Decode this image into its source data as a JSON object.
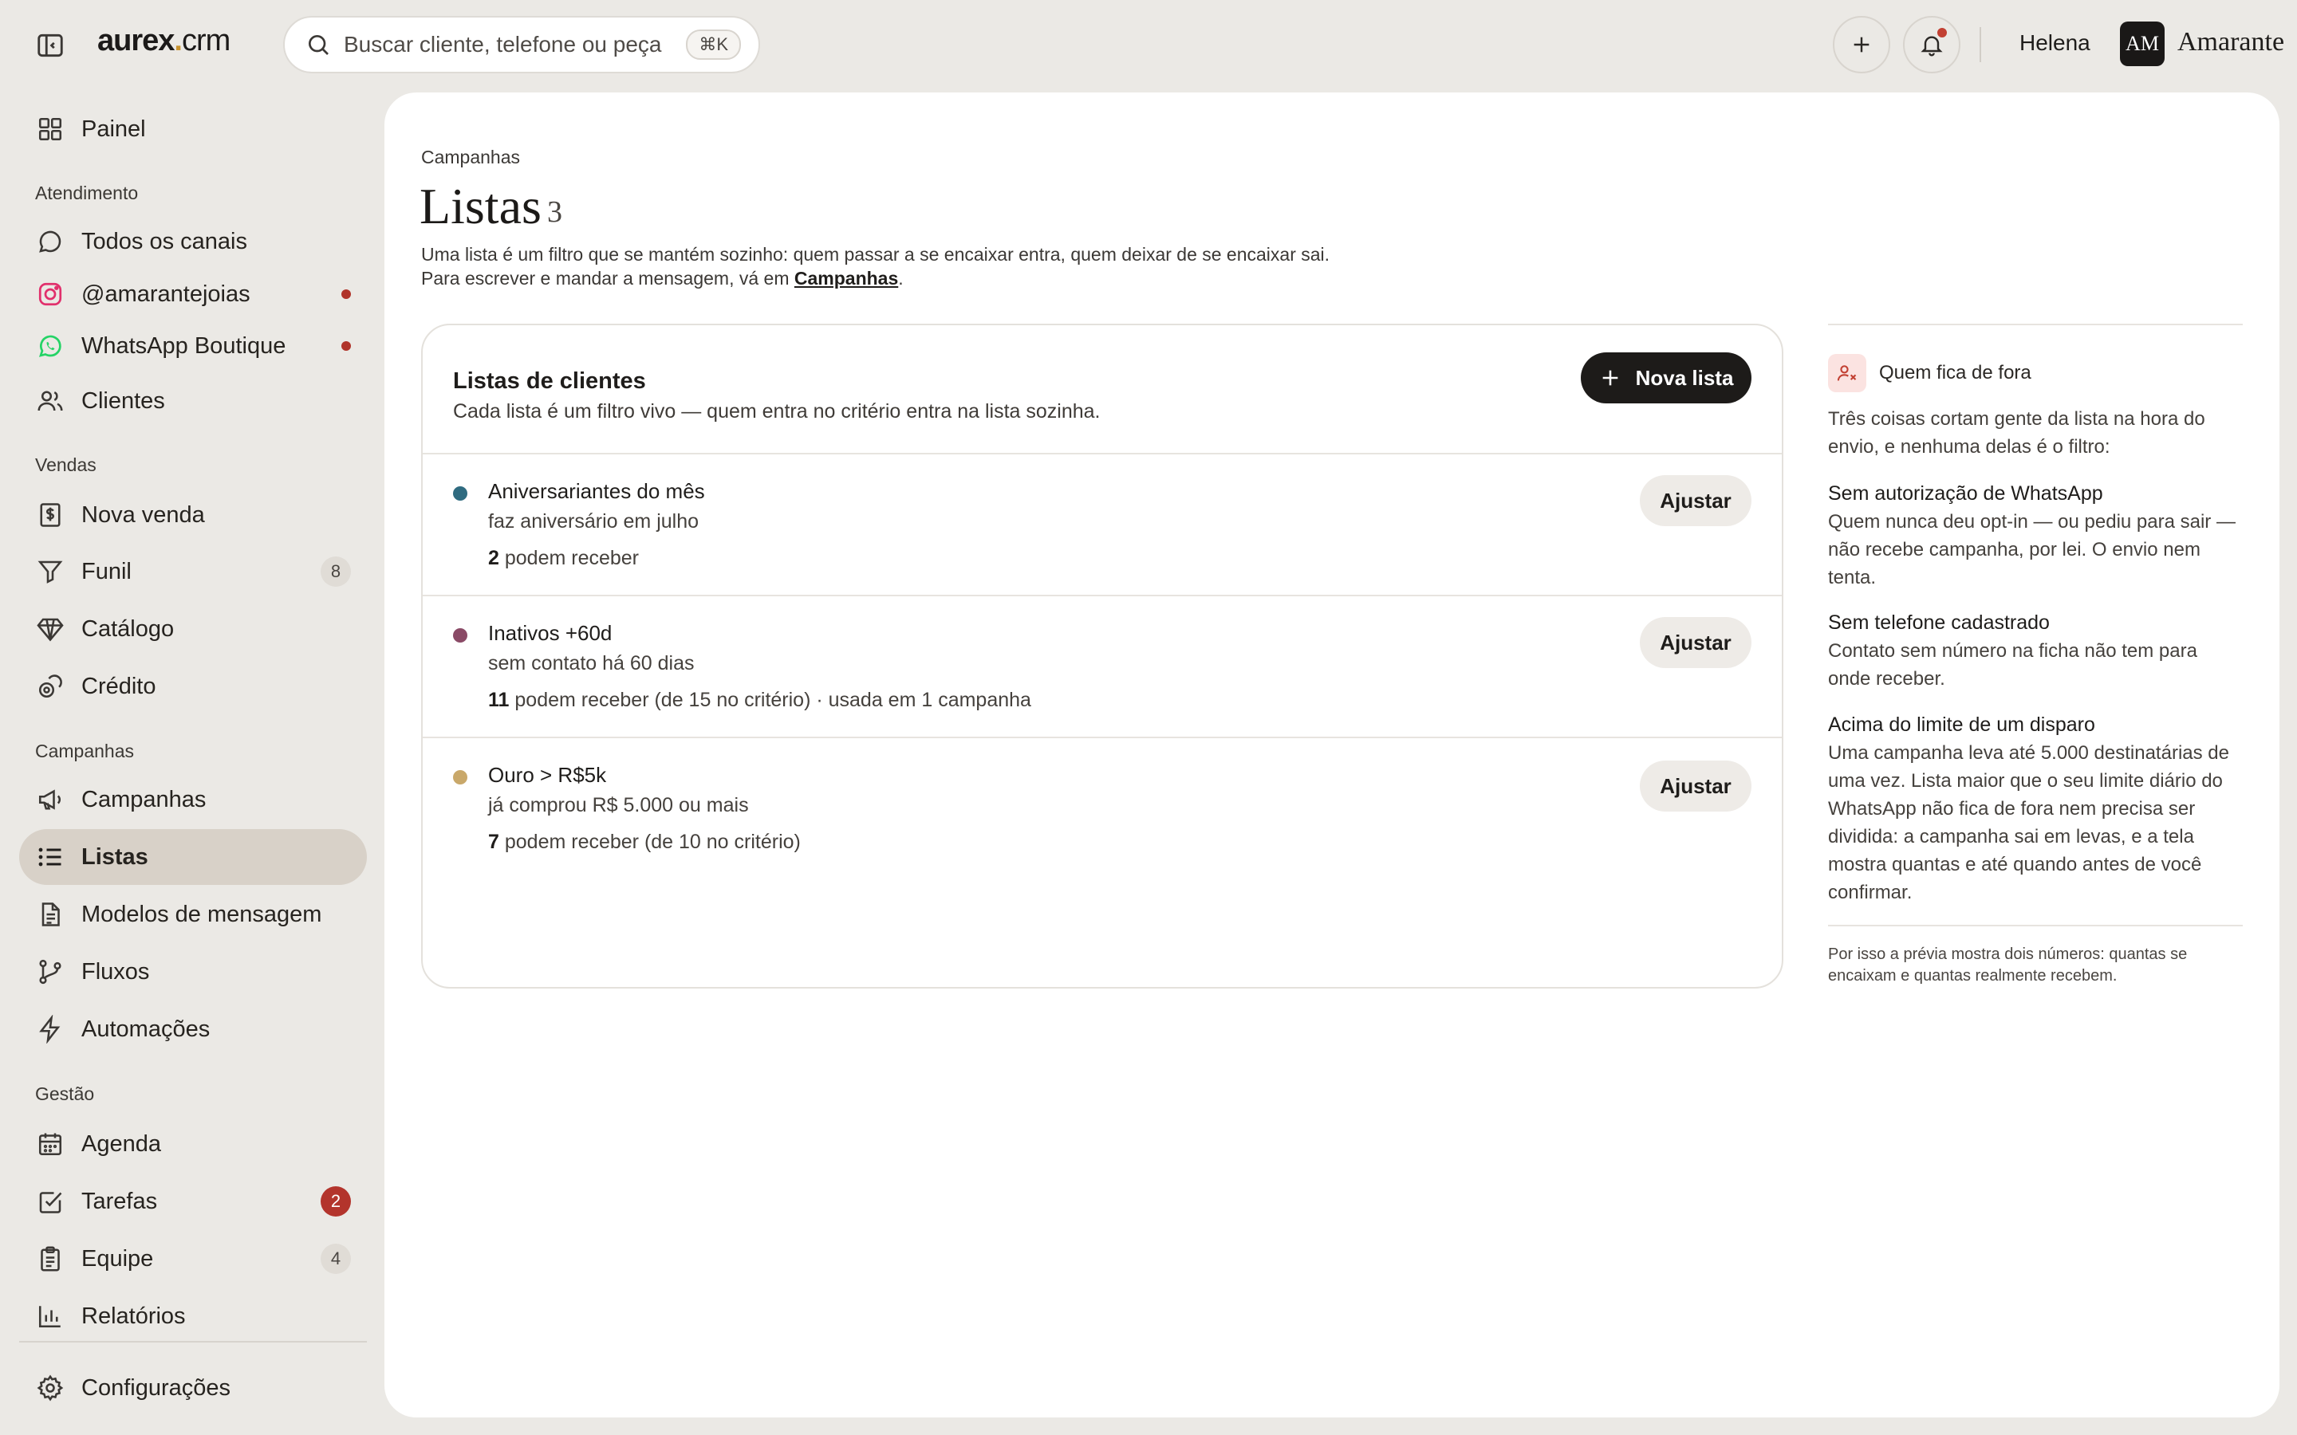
{
  "app": {
    "logo_bold": "aurex",
    "logo_dot": ".",
    "logo_light": "crm",
    "search_placeholder": "Buscar cliente, telefone ou peça",
    "search_shortcut": "⌘K",
    "user_name": "Helena",
    "avatar_initials": "AM",
    "org_name": "Amarante"
  },
  "sidebar": {
    "dashboard": "Painel",
    "sections": {
      "service": "Atendimento",
      "sales": "Vendas",
      "campaigns": "Campanhas",
      "management": "Gestão"
    },
    "items": {
      "all_channels": "Todos os canais",
      "instagram": "@amarantejoias",
      "whatsapp": "WhatsApp Boutique",
      "clients": "Clientes",
      "new_sale": "Nova venda",
      "funnel": "Funil",
      "funnel_count": "8",
      "catalog": "Catálogo",
      "credit": "Crédito",
      "campaigns": "Campanhas",
      "lists": "Listas",
      "templates": "Modelos de mensagem",
      "flows": "Fluxos",
      "automations": "Automações",
      "calendar": "Agenda",
      "tasks": "Tarefas",
      "tasks_count": "2",
      "team": "Equipe",
      "team_count": "4",
      "reports": "Relatórios",
      "settings": "Configurações"
    }
  },
  "page": {
    "breadcrumb": "Campanhas",
    "title": "Listas",
    "count": "3",
    "description_line1": "Uma lista é um filtro que se mantém sozinho: quem passar a se encaixar entra, quem deixar de se encaixar sai.",
    "description_line2_prefix": "Para escrever e mandar a mensagem, vá em ",
    "description_link": "Campanhas",
    "description_line2_suffix": "."
  },
  "card": {
    "title": "Listas de clientes",
    "subtitle": "Cada lista é um filtro vivo — quem entra no critério entra na lista sozinha.",
    "new_button": "Nova lista",
    "adjust_label": "Ajustar",
    "lists": [
      {
        "name": "Aniversariantes do mês",
        "criteria": "faz aniversário em julho",
        "count": "2",
        "stats": " podem receber",
        "color": "#2f6b80"
      },
      {
        "name": "Inativos +60d",
        "criteria": "sem contato há 60 dias",
        "count": "11",
        "stats": " podem receber (de 15 no critério) · usada em 1 campanha",
        "color": "#8a4a66"
      },
      {
        "name": "Ouro > R$5k",
        "criteria": "já comprou R$ 5.000 ou mais",
        "count": "7",
        "stats": " podem receber (de 10 no critério)",
        "color": "#c9a86a"
      }
    ]
  },
  "info": {
    "title": "Quem fica de fora",
    "intro": "Três coisas cortam gente da lista na hora do envio, e nenhuma delas é o filtro:",
    "items": [
      {
        "head": "Sem autorização de WhatsApp",
        "text": "Quem nunca deu opt-in — ou pediu para sair — não recebe campanha, por lei. O envio nem tenta."
      },
      {
        "head": "Sem telefone cadastrado",
        "text": "Contato sem número na ficha não tem para onde receber."
      },
      {
        "head": "Acima do limite de um disparo",
        "text": "Uma campanha leva até 5.000 destinatárias de uma vez. Lista maior que o seu limite diário do WhatsApp não fica de fora nem precisa ser dividida: a campanha sai em levas, e a tela mostra quantas e até quando antes de você confirmar."
      }
    ],
    "footer": "Por isso a prévia mostra dois números: quantas se encaixam e quantas realmente recebem."
  },
  "colors": {
    "accent_dark": "#1d1b19",
    "active_nav": "#d8d1c8",
    "alert_red": "#b3342c",
    "instagram": "#e1306c",
    "whatsapp": "#25d366",
    "logo_dot": "#c8932f"
  }
}
